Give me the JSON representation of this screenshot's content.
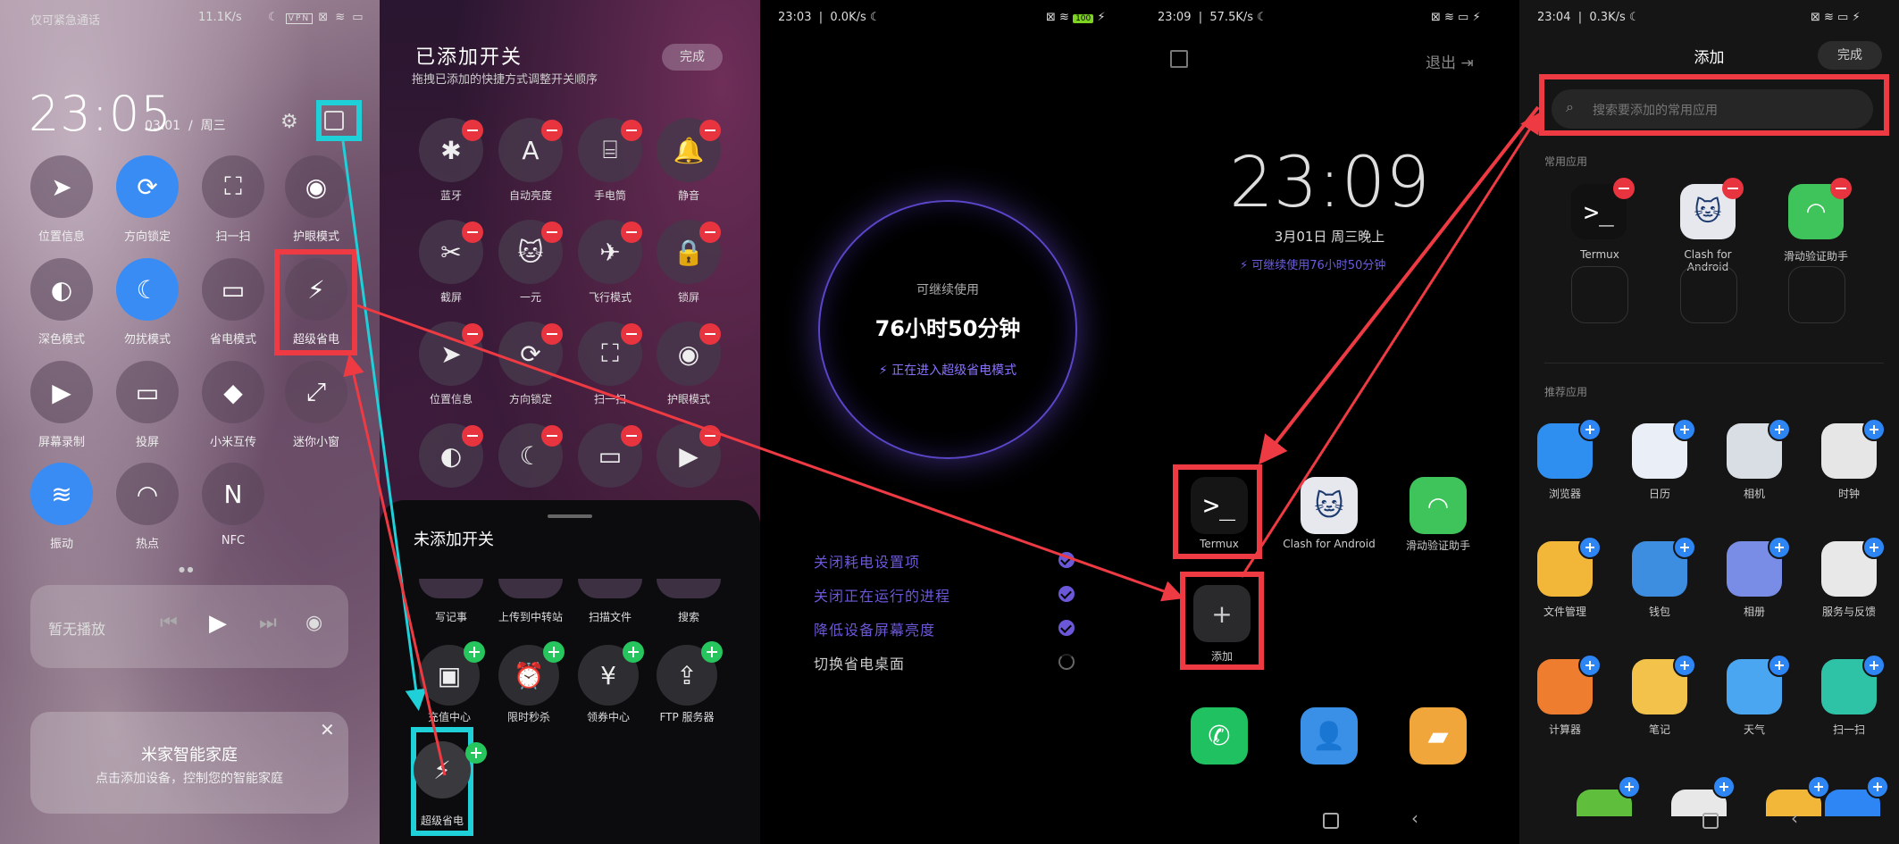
{
  "p1": {
    "carrier": "仅可紧急通话",
    "net_speed": "11.1K/s",
    "time": "23:05",
    "date": "03.01",
    "weekday": "周三",
    "tiles": [
      {
        "label": "位置信息",
        "icon": "location-arrow-icon"
      },
      {
        "label": "方向锁定",
        "icon": "rotation-lock-icon"
      },
      {
        "label": "扫一扫",
        "icon": "scan-icon"
      },
      {
        "label": "护眼模式",
        "icon": "eye-icon"
      },
      {
        "label": "深色模式",
        "icon": "dark-mode-icon"
      },
      {
        "label": "勿扰模式",
        "icon": "moon-icon"
      },
      {
        "label": "省电模式",
        "icon": "battery-saver-icon"
      },
      {
        "label": "超级省电",
        "icon": "bolt-icon"
      },
      {
        "label": "屏幕录制",
        "icon": "camera-record-icon"
      },
      {
        "label": "投屏",
        "icon": "cast-screen-icon"
      },
      {
        "label": "小米互传",
        "icon": "mi-share-icon"
      },
      {
        "label": "迷你小窗",
        "icon": "mini-window-icon"
      },
      {
        "label": "振动",
        "icon": "vibrate-icon"
      },
      {
        "label": "热点",
        "icon": "hotspot-icon"
      },
      {
        "label": "NFC",
        "icon": "nfc-icon"
      }
    ],
    "media_text": "暂无播放",
    "home_title": "米家智能家庭",
    "home_sub": "点击添加设备，控制您的智能家庭"
  },
  "p2": {
    "title": "已添加开关",
    "subtitle": "拖拽已添加的快捷方式调整开关顺序",
    "done": "完成",
    "added": [
      {
        "label": "蓝牙",
        "glyph": "✱"
      },
      {
        "label": "自动亮度",
        "glyph": "A"
      },
      {
        "label": "手电筒",
        "glyph": "⌸"
      },
      {
        "label": "静音",
        "glyph": "🔔"
      },
      {
        "label": "截屏",
        "glyph": "✂"
      },
      {
        "label": "一元",
        "glyph": "🐱"
      },
      {
        "label": "飞行模式",
        "glyph": "✈"
      },
      {
        "label": "锁屏",
        "glyph": "🔒"
      },
      {
        "label": "位置信息",
        "glyph": "➤"
      },
      {
        "label": "方向锁定",
        "glyph": "⟳"
      },
      {
        "label": "扫一扫",
        "glyph": "⛶"
      },
      {
        "label": "护眼模式",
        "glyph": "◉"
      },
      {
        "label": "",
        "glyph": "◐"
      },
      {
        "label": "",
        "glyph": "☾"
      },
      {
        "label": "",
        "glyph": "▭"
      },
      {
        "label": "",
        "glyph": "▶"
      }
    ],
    "not_added_title": "未添加开关",
    "not_added_row1": [
      "写记事",
      "上传到中转站",
      "扫描文件",
      "搜索"
    ],
    "not_added_row2": [
      {
        "label": "充值中心",
        "glyph": "▣"
      },
      {
        "label": "限时秒杀",
        "glyph": "⏰"
      },
      {
        "label": "领券中心",
        "glyph": "¥"
      },
      {
        "label": "FTP 服务器",
        "glyph": "⇪"
      }
    ],
    "highlight_label": "超级省电"
  },
  "p3": {
    "time": "23:03",
    "speed": "0.0K/s",
    "battery": "100",
    "circle_top": "可继续使用",
    "circle_main": "76小时50分钟",
    "circle_status": "正在进入超级省电模式",
    "steps": [
      {
        "text": "关闭耗电设置项",
        "state": "done"
      },
      {
        "text": "关闭正在运行的进程",
        "state": "done"
      },
      {
        "text": "降低设备屏幕亮度",
        "state": "done"
      },
      {
        "text": "切换省电桌面",
        "state": "loading"
      }
    ]
  },
  "p4": {
    "time": "23:09",
    "speed": "57.5K/s",
    "exit": "退出",
    "clock": "23:09",
    "date": "3月01日  周三晚上",
    "remaining": "可继续使用76小时50分钟",
    "apps": [
      {
        "label": "Termux"
      },
      {
        "label": "Clash for Android"
      },
      {
        "label": "滑动验证助手"
      }
    ],
    "add": "添加"
  },
  "p5": {
    "time": "23:04",
    "speed": "0.3K/s",
    "title": "添加",
    "done": "完成",
    "search_placeholder": "搜索要添加的常用应用",
    "common_title": "常用应用",
    "common": [
      "Termux",
      "Clash for Android",
      "滑动验证助手"
    ],
    "recommend_title": "推荐应用",
    "recommend": [
      {
        "label": "浏览器",
        "color": "#2f8ff0"
      },
      {
        "label": "日历",
        "color": "#e9eef7"
      },
      {
        "label": "相机",
        "color": "#d9dde4"
      },
      {
        "label": "时钟",
        "color": "#e6e6e6"
      },
      {
        "label": "文件管理",
        "color": "#f2b739"
      },
      {
        "label": "钱包",
        "color": "#3d8de0"
      },
      {
        "label": "相册",
        "color": "#7a8de6"
      },
      {
        "label": "服务与反馈",
        "color": "#e8e8e8"
      },
      {
        "label": "计算器",
        "color": "#ef7d30"
      },
      {
        "label": "笔记",
        "color": "#f3c24a"
      },
      {
        "label": "天气",
        "color": "#4aa6f0"
      },
      {
        "label": "扫一扫",
        "color": "#2ec2a6"
      }
    ]
  }
}
